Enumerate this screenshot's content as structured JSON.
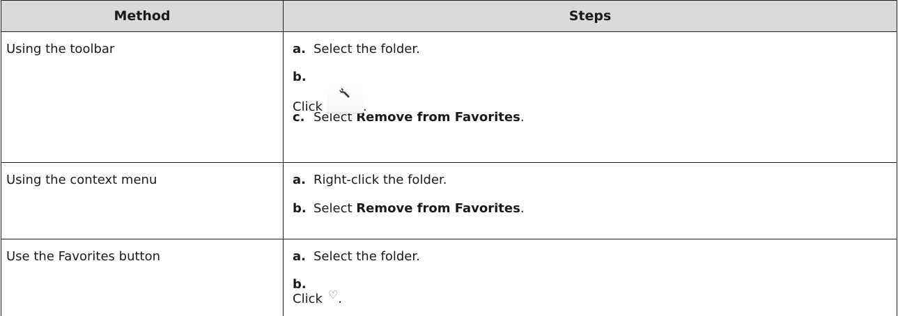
{
  "table": {
    "headers": {
      "method": "Method",
      "steps": "Steps"
    },
    "rows": [
      {
        "method": "Using the toolbar",
        "steps": [
          {
            "letter": "a.",
            "pre": "Select the folder.",
            "bold": "",
            "post": ""
          },
          {
            "letter": "b.",
            "pre": "Click",
            "icon": "wrench-icon",
            "post": "."
          },
          {
            "letter": "c.",
            "pre": "Select ",
            "bold": "Remove from Favorites",
            "post": "."
          }
        ]
      },
      {
        "method": "Using the context menu",
        "steps": [
          {
            "letter": "a.",
            "pre": "Right-click the folder.",
            "bold": "",
            "post": ""
          },
          {
            "letter": "b.",
            "pre": "Select ",
            "bold": "Remove from Favorites",
            "post": "."
          }
        ]
      },
      {
        "method": "Use the Favorites button",
        "steps": [
          {
            "letter": "a.",
            "pre": "Select the folder.",
            "bold": "",
            "post": ""
          },
          {
            "letter": "b.",
            "pre": "Click",
            "icon": "heart-icon",
            "post": "."
          }
        ]
      }
    ]
  },
  "colors": {
    "header_bg": "#dadada",
    "border": "#1a1a1a",
    "text": "#1a1a1a"
  }
}
